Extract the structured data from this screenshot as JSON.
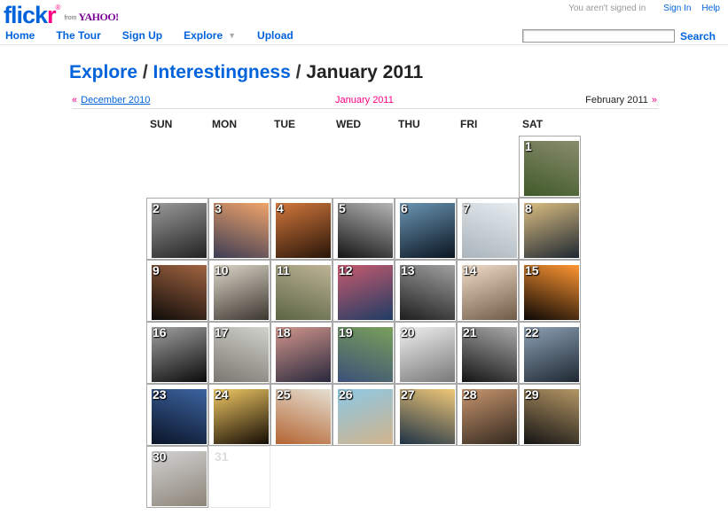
{
  "header": {
    "logo_word": "flick",
    "logo_r": "r",
    "logo_reg": "®",
    "logo_from": "from",
    "logo_yahoo": "YAHOO!",
    "status": "You aren't signed in",
    "sign_in": "Sign In",
    "help": "Help"
  },
  "nav": {
    "home": "Home",
    "tour": "The Tour",
    "signup": "Sign Up",
    "explore": "Explore",
    "upload": "Upload"
  },
  "search": {
    "value": "",
    "button": "Search"
  },
  "breadcrumb": {
    "explore": "Explore",
    "sep": " / ",
    "interestingness": "Interestingness",
    "current": "January 2011"
  },
  "month_nav": {
    "prev_arrow": "«",
    "prev": "December 2010",
    "current": "January 2011",
    "next": "February 2011",
    "next_arrow": "»"
  },
  "weekdays": [
    "SUN",
    "MON",
    "TUE",
    "WED",
    "THU",
    "FRI",
    "SAT"
  ],
  "calendar": {
    "first_weekday": 6,
    "days": [
      {
        "day": "1",
        "c1": "#8a8c6c",
        "c2": "#3f5a2a"
      },
      {
        "day": "2",
        "c1": "#9a9a9a",
        "c2": "#222222"
      },
      {
        "day": "3",
        "c1": "#f0a46a",
        "c2": "#3c3c54"
      },
      {
        "day": "4",
        "c1": "#d2783c",
        "c2": "#281408"
      },
      {
        "day": "5",
        "c1": "#b4b4b4",
        "c2": "#141414"
      },
      {
        "day": "6",
        "c1": "#6a96b4",
        "c2": "#0a1420"
      },
      {
        "day": "7",
        "c1": "#e6ecf0",
        "c2": "#aab4bc"
      },
      {
        "day": "8",
        "c1": "#dcbe82",
        "c2": "#1e2832"
      },
      {
        "day": "9",
        "c1": "#a06440",
        "c2": "#100c0a"
      },
      {
        "day": "10",
        "c1": "#dcd6c8",
        "c2": "#3c3630"
      },
      {
        "day": "11",
        "c1": "#beb496",
        "c2": "#5a6444"
      },
      {
        "day": "12",
        "c1": "#c85a6e",
        "c2": "#1e3c64"
      },
      {
        "day": "13",
        "c1": "#a0a0a0",
        "c2": "#1e1e1e"
      },
      {
        "day": "14",
        "c1": "#f0dcc8",
        "c2": "#6e5a46"
      },
      {
        "day": "15",
        "c1": "#ff9632",
        "c2": "#0a0604"
      },
      {
        "day": "16",
        "c1": "#a0a0a0",
        "c2": "#0a0a0a"
      },
      {
        "day": "17",
        "c1": "#d2d2cc",
        "c2": "#787870"
      },
      {
        "day": "18",
        "c1": "#d2968c",
        "c2": "#28283c"
      },
      {
        "day": "19",
        "c1": "#78a05a",
        "c2": "#3c5078"
      },
      {
        "day": "20",
        "c1": "#f0f0f0",
        "c2": "#787878"
      },
      {
        "day": "21",
        "c1": "#aaaaaa",
        "c2": "#141414"
      },
      {
        "day": "22",
        "c1": "#8ca0b4",
        "c2": "#1e2832"
      },
      {
        "day": "23",
        "c1": "#3c64a0",
        "c2": "#0a1428"
      },
      {
        "day": "24",
        "c1": "#f0c864",
        "c2": "#140c04"
      },
      {
        "day": "25",
        "c1": "#e6e0d2",
        "c2": "#b46432"
      },
      {
        "day": "26",
        "c1": "#8cc8e6",
        "c2": "#d2b48c"
      },
      {
        "day": "27",
        "c1": "#f0c878",
        "c2": "#1e3246"
      },
      {
        "day": "28",
        "c1": "#c8966e",
        "c2": "#32281e"
      },
      {
        "day": "29",
        "c1": "#b49664",
        "c2": "#141414"
      },
      {
        "day": "30",
        "c1": "#d2d2d2",
        "c2": "#8c8478"
      }
    ],
    "past_days": [
      {
        "day": "31"
      }
    ]
  }
}
